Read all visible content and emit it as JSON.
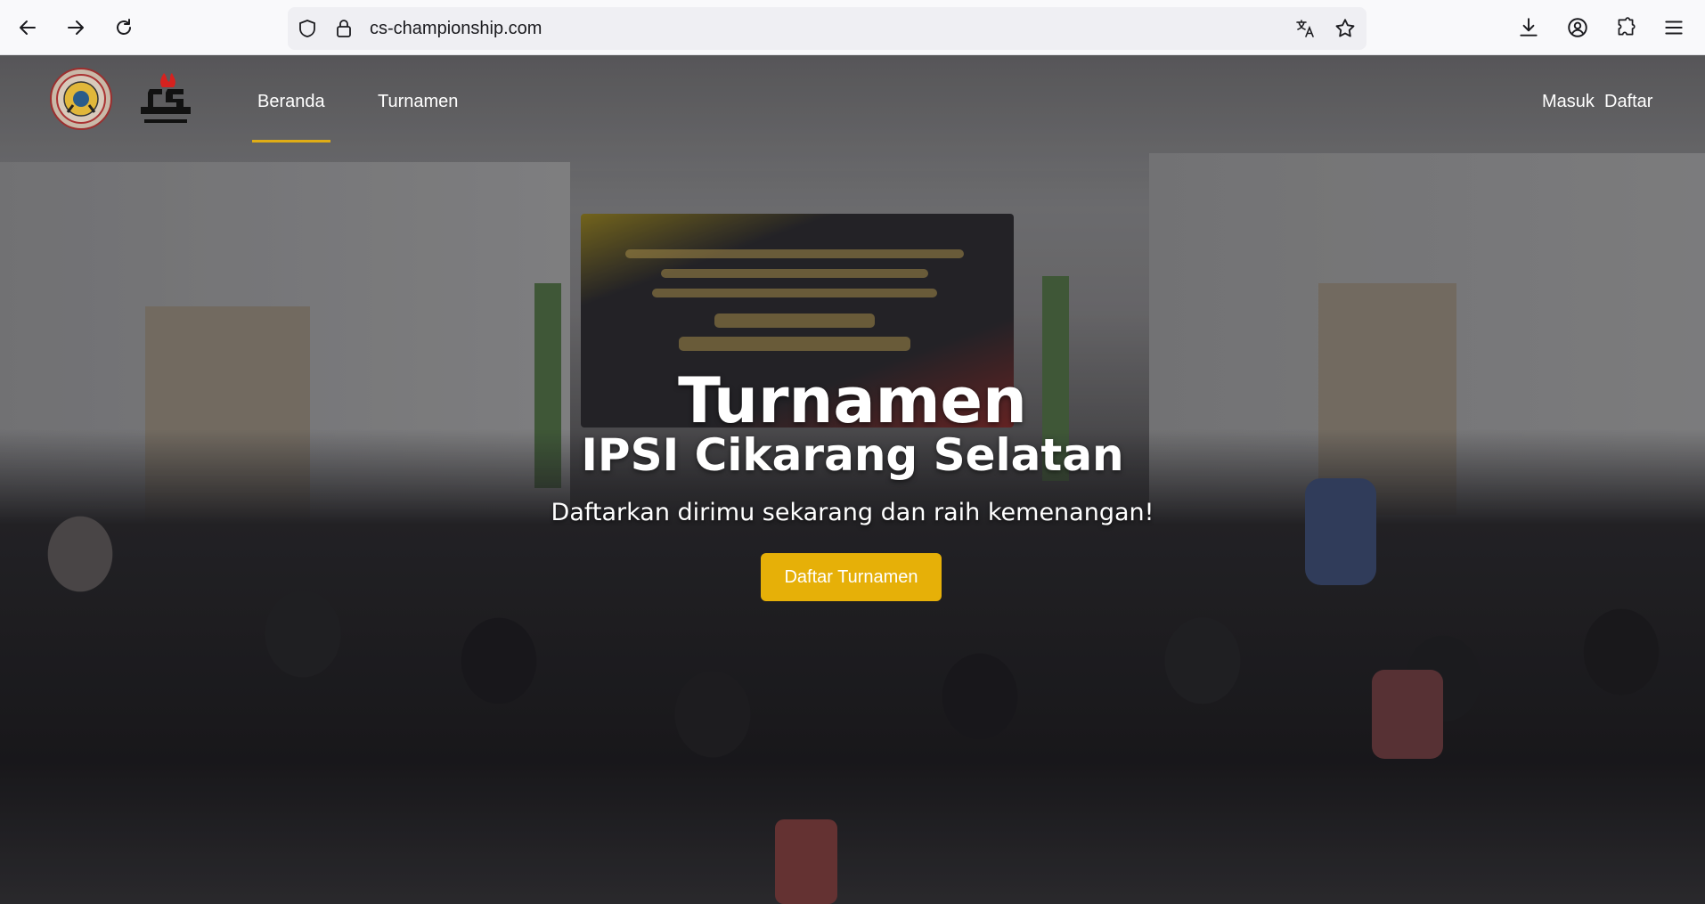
{
  "browser": {
    "url": "cs-championship.com",
    "icons": {
      "back": "arrow-left-icon",
      "forward": "arrow-right-icon",
      "reload": "reload-icon",
      "shield": "shield-icon",
      "lock": "lock-icon",
      "translate": "translate-icon",
      "bookmark": "star-icon",
      "downloads": "download-icon",
      "account": "account-icon",
      "extensions": "puzzle-icon",
      "menu": "hamburger-icon"
    }
  },
  "site": {
    "nav": {
      "links": [
        "Beranda",
        "Turnamen"
      ],
      "active": "Beranda",
      "auth": {
        "login": "Masuk",
        "register": "Daftar"
      }
    },
    "hero": {
      "title": "Turnamen",
      "subtitle": "IPSI Cikarang Selatan",
      "tagline": "Daftarkan dirimu sekarang dan raih kemenangan!",
      "cta_label": "Daftar Turnamen"
    },
    "colors": {
      "accent": "#e6b008",
      "active_underline": "#e0ad16",
      "nav_text": "#ffffff"
    }
  }
}
